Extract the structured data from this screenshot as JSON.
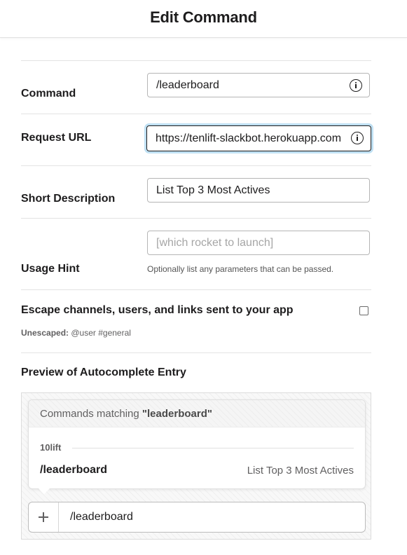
{
  "header": {
    "title": "Edit Command"
  },
  "form": {
    "command": {
      "label": "Command",
      "value": "/leaderboard"
    },
    "request_url": {
      "label": "Request URL",
      "value": "https://tenlift-slackbot.herokuapp.com"
    },
    "short_description": {
      "label": "Short Description",
      "value": "List Top 3 Most Actives"
    },
    "usage_hint": {
      "label": "Usage Hint",
      "placeholder": "[which rocket to launch]",
      "hint": "Optionally list any parameters that can be passed."
    },
    "escape": {
      "label": "Escape channels, users, and links sent to your app",
      "checked": false,
      "example_label": "Unescaped:",
      "example_value": "@user #general"
    }
  },
  "preview": {
    "title": "Preview of Autocomplete Entry",
    "matching_prefix": "Commands matching ",
    "matching_query": "\"leaderboard\"",
    "group": "10lift",
    "command": "/leaderboard",
    "description": "List Top 3 Most Actives",
    "message_input": "/leaderboard"
  },
  "colors": {
    "focus_ring": "#bfe0f3",
    "text": "#1d1c1d",
    "muted": "#616061"
  }
}
